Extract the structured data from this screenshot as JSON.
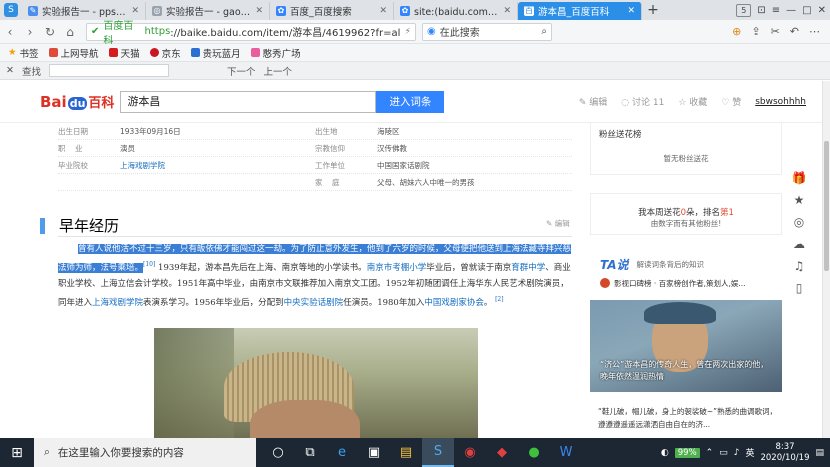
{
  "tabs": [
    {
      "label": "实验报告一 - ppsuc177 -",
      "icon_color": "#4b8ef0"
    },
    {
      "label": "实验报告一 - gaojianpps",
      "icon_color": "#9aa3ad"
    },
    {
      "label": "百度_百度搜索",
      "icon_color": "#3385ff"
    },
    {
      "label": "site:(baidu.com) 6月28日",
      "icon_color": "#3385ff"
    },
    {
      "label": "游本昌_百度百科",
      "icon_color": "#ffffff"
    }
  ],
  "tab_count": "5",
  "address": {
    "site_label": "百度百科",
    "https": "https",
    "url_rest": "://baike.baidu.com/item/游本昌/4619962?fr=aladc",
    "search_placeholder": "在此搜索"
  },
  "bookmarks": [
    "书签",
    "上网导航",
    "天猫",
    "京东",
    "贵玩蓝月",
    "憨秀广场"
  ],
  "findbar": {
    "label": "查找",
    "next": "下一个",
    "prev": "上一个"
  },
  "header": {
    "logo_bai": "Bai",
    "logo_du": "du",
    "logo_baike": "百科",
    "search_value": "游本昌",
    "search_button": "进入词条",
    "actions": [
      "编辑",
      "讨论 11",
      "收藏",
      "赞"
    ],
    "user": "sbwsohhhh"
  },
  "info_rows": [
    {
      "l1": "出生日期",
      "v1": "1933年09月16日",
      "l2": "出生地",
      "v2": "海陵区"
    },
    {
      "l1": "职    业",
      "v1": "演员",
      "l2": "宗教信仰",
      "v2": "汉传佛教"
    },
    {
      "l1": "毕业院校",
      "v1": "上海戏剧学院",
      "l2": "工作单位",
      "v2": "中国国家话剧院"
    },
    {
      "l1": "",
      "v1": "",
      "l2": "家    庭",
      "v2": "父母、胡妹六人中唯一的男孩"
    }
  ],
  "section": {
    "title": "早年经历",
    "edit": "编辑"
  },
  "paragraph": {
    "highlight": "曾有人说他活不过十三岁，只有皈依佛才能闯过这一劫。为了防止意外发生，他到了六岁的时候，父母便把他送到上海法藏寺拜兴慈法师为师，法号乘培。",
    "ref1": "[10]",
    "t1": "1939年起，游本昌先后在上海、南京等地的小学读书。",
    "link1": "南京市考棚小学",
    "t2": "毕业后，曾就读于南京",
    "link2": "育群中学",
    "t3": "、商业职业学校、上海立信会计学校。1951年高中毕业，由南京市文联推荐加入南京文工团。1952年初随团调任上海华东人民艺术剧院演员，同年进入",
    "link3": "上海戏剧学院",
    "t4": "表演系学习。1956年毕业后，分配到",
    "link4": "中央实验话剧院",
    "t5": "任演员。1980年加入",
    "link5": "中国戏剧家协会",
    "t6": "。",
    "ref2": "[2]"
  },
  "sidebar": {
    "fans_title": "粉丝送花榜",
    "fans_empty": "暂无粉丝送花",
    "rank_pre": "我本周送花",
    "rank_count": "0",
    "rank_mid": "朵，排名",
    "rank_num": "第1",
    "rank_sub": "由数字而有其他粉丝!",
    "ta_logo": "TA说",
    "ta_sub": "解读词条背后的知识",
    "card_author": "影视口碑榜 · 百家榜创作者,策划人,娱...",
    "caption": "“济公”游本昌的传奇人生，曾在两次出家的他，晚年依然温润热情",
    "desc": "“鞋儿破，帽儿破，身上的袈裟破~”熟悉的曲调歌词，遵遵遵遥遥远潇洒自由自在的济..."
  },
  "taskbar": {
    "search_placeholder": "在这里输入你要搜索的内容",
    "battery": "99%",
    "time": "8:37",
    "date": "2020/10/19"
  }
}
